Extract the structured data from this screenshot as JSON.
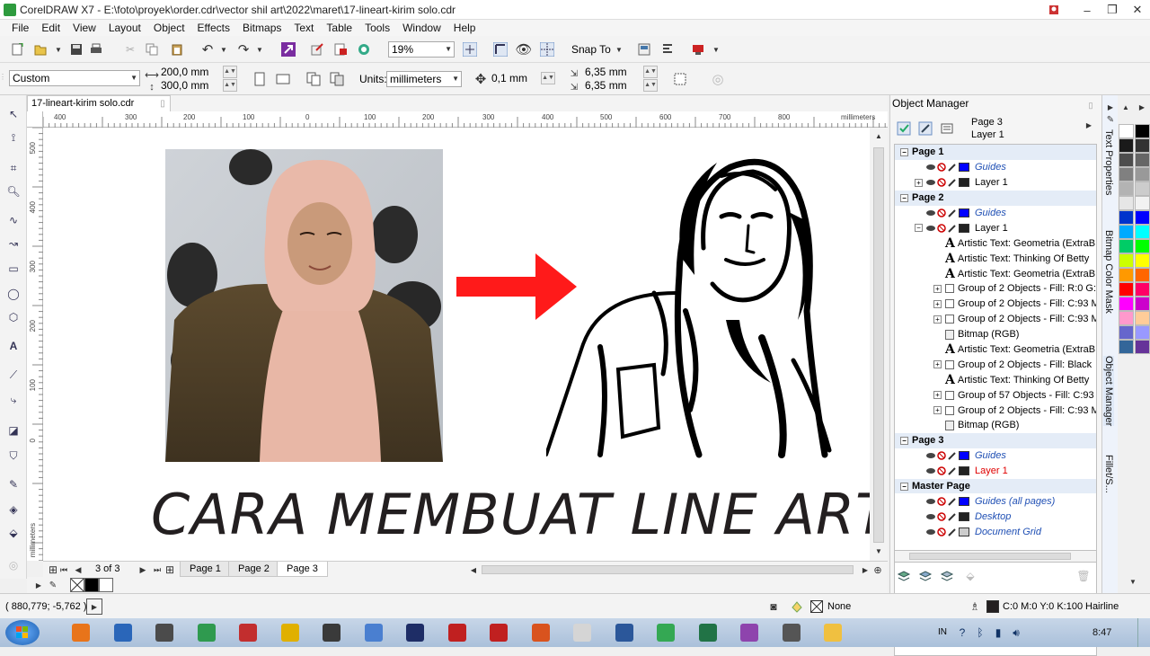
{
  "window": {
    "title": "CorelDRAW X7 - E:\\foto\\proyek\\order.cdr\\vector shil art\\2022\\maret\\17-lineart-kirim solo.cdr",
    "controls": [
      "–",
      "❐",
      "✕"
    ]
  },
  "menu": [
    "File",
    "Edit",
    "View",
    "Layout",
    "Object",
    "Effects",
    "Bitmaps",
    "Text",
    "Table",
    "Tools",
    "Window",
    "Help"
  ],
  "standard_toolbar": {
    "zoom_level": "19%",
    "snap_to_label": "Snap To"
  },
  "property_bar": {
    "page_size_preset": "Custom",
    "page_width": "200,0 mm",
    "page_height": "300,0 mm",
    "units_label": "Units:",
    "units_value": "millimeters",
    "nudge_distance": "0,1 mm",
    "duplicate_x": "6,35 mm",
    "duplicate_y": "6,35 mm"
  },
  "document": {
    "tab_label": "17-lineart-kirim solo.cdr",
    "ruler_unit": "millimeters",
    "hruler_ticks": [
      "400",
      "300",
      "200",
      "100",
      "0",
      "100",
      "200",
      "300",
      "400",
      "500",
      "600",
      "700",
      "800"
    ],
    "vruler_ticks": [
      "500",
      "400",
      "300",
      "200",
      "100",
      "0"
    ],
    "canvas_title": "CARA MEMBUAT LINE ART"
  },
  "page_nav": {
    "position": "3 of 3",
    "pages": [
      "Page 1",
      "Page 2",
      "Page 3"
    ],
    "active_page": "Page 3"
  },
  "object_manager": {
    "title": "Object Manager",
    "current_page": "Page 3",
    "current_layer": "Layer 1",
    "rows": [
      {
        "type": "page",
        "label": "Page 1"
      },
      {
        "type": "layer",
        "label": "Guides",
        "swatch": "#0000ff",
        "style": "blue"
      },
      {
        "type": "layer",
        "label": "Layer 1",
        "swatch": "#222222",
        "style": "normal",
        "exp": "+"
      },
      {
        "type": "page",
        "label": "Page 2"
      },
      {
        "type": "layer",
        "label": "Guides",
        "swatch": "#0000ff",
        "style": "blue"
      },
      {
        "type": "layer",
        "label": "Layer 1",
        "swatch": "#222222",
        "style": "normal",
        "exp": "−"
      },
      {
        "type": "text",
        "label": "Artistic Text: Geometria (ExtraB"
      },
      {
        "type": "text",
        "label": "Artistic Text: Thinking Of Betty"
      },
      {
        "type": "text",
        "label": "Artistic Text: Geometria (ExtraB"
      },
      {
        "type": "group",
        "label": "Group of 2 Objects - Fill: R:0 G:"
      },
      {
        "type": "group",
        "label": "Group of 2 Objects - Fill: C:93 M"
      },
      {
        "type": "group",
        "label": "Group of 2 Objects - Fill: C:93 M"
      },
      {
        "type": "bitmap",
        "label": "Bitmap (RGB)"
      },
      {
        "type": "text",
        "label": "Artistic Text: Geometria (ExtraB"
      },
      {
        "type": "group",
        "label": "Group of 2 Objects - Fill: Black"
      },
      {
        "type": "text",
        "label": "Artistic Text: Thinking Of Betty"
      },
      {
        "type": "group",
        "label": "Group of 57 Objects - Fill: C:93"
      },
      {
        "type": "group",
        "label": "Group of 2 Objects - Fill: C:93 M"
      },
      {
        "type": "bitmap",
        "label": "Bitmap (RGB)"
      },
      {
        "type": "page",
        "label": "Page 3"
      },
      {
        "type": "layer",
        "label": "Guides",
        "swatch": "#0000ff",
        "style": "blue"
      },
      {
        "type": "layer",
        "label": "Layer 1",
        "swatch": "#222222",
        "style": "red"
      },
      {
        "type": "page",
        "label": "Master Page"
      },
      {
        "type": "layer",
        "label": "Guides (all pages)",
        "swatch": "#0000ff",
        "style": "blue"
      },
      {
        "type": "layer",
        "label": "Desktop",
        "swatch": "#222222",
        "style": "blue"
      },
      {
        "type": "layer",
        "label": "Document Grid",
        "swatch": "#cccccc",
        "style": "blue"
      }
    ]
  },
  "dockers": [
    "Text Properties",
    "Bitmap Color Mask",
    "Object Manager",
    "Fillet/S..."
  ],
  "palette_colors": [
    "#ffffff",
    "#000000",
    "#1a1a1a",
    "#333333",
    "#4d4d4d",
    "#666666",
    "#808080",
    "#999999",
    "#b3b3b3",
    "#cccccc",
    "#e6e6e6",
    "#f2f2f2",
    "#0033cc",
    "#0000ff",
    "#00aaff",
    "#00ffff",
    "#00cc66",
    "#00ff00",
    "#ccff00",
    "#ffff00",
    "#ff9900",
    "#ff6600",
    "#ff0000",
    "#ff0066",
    "#ff00ff",
    "#cc00cc",
    "#ff99cc",
    "#ffcc99",
    "#6666cc",
    "#9999ff",
    "#336699",
    "#663399"
  ],
  "status": {
    "coords": "( 880,779; -5,762 )",
    "fill_label": "None",
    "outline_color": "C:0 M:0 Y:0 K:100",
    "outline_width": "Hairline"
  },
  "taskbar": {
    "time": "8:47",
    "lang": "IN",
    "app_colors": [
      "#e8741a",
      "#2a66b9",
      "#4b4b4b",
      "#2f9a4f",
      "#c22e2e",
      "#e0b000",
      "#3a3a3a",
      "#4a7fd0",
      "#1e2d66",
      "#c02020",
      "#c02020",
      "#d9531e",
      "#d5d5d5",
      "#2b579a",
      "#34a853",
      "#217346",
      "#8e44ad",
      "#555555",
      "#f0c040"
    ]
  }
}
